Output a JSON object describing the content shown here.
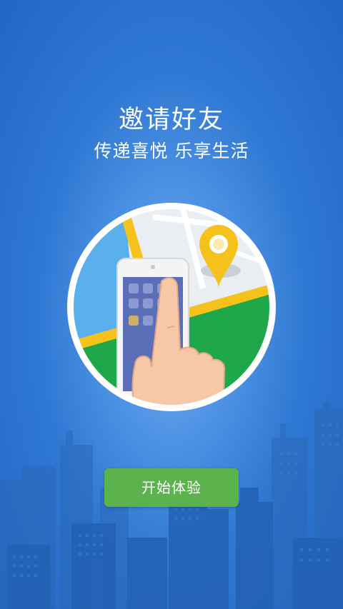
{
  "header": {
    "title": "邀请好友",
    "subtitle": "传递喜悦 乐享生活"
  },
  "illustration": {
    "icon": "phone-map-tap-icon"
  },
  "actions": {
    "start_label": "开始体验"
  },
  "colors": {
    "background": "#2f78d2",
    "button": "#5cb34e",
    "pin": "#f5c21b",
    "park": "#1fa84a"
  }
}
